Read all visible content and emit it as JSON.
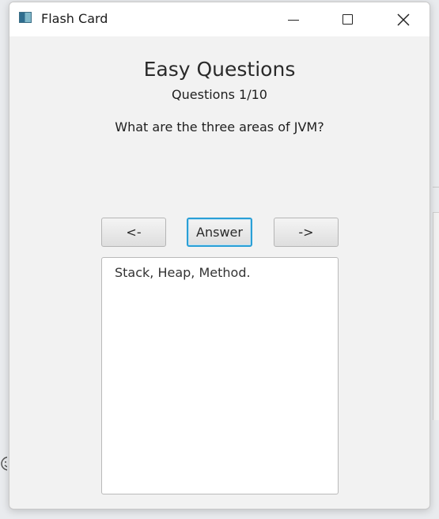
{
  "window": {
    "title": "Flash Card",
    "app_icon": "java-app-icon"
  },
  "titlebar_controls": {
    "minimize_icon": "minimize-icon",
    "maximize_icon": "maximize-icon",
    "close_icon": "close-icon"
  },
  "content": {
    "heading": "Easy Questions",
    "progress": "Questions 1/10",
    "question": "What are the three areas of JVM?"
  },
  "buttons": {
    "prev_label": "<-",
    "answer_label": "Answer",
    "next_label": "->"
  },
  "answer_area": {
    "text": "Stack, Heap, Method."
  },
  "colors": {
    "focus_accent": "#2a9fd6",
    "window_bg": "#f2f2f2",
    "titlebar_bg": "#ffffff"
  }
}
